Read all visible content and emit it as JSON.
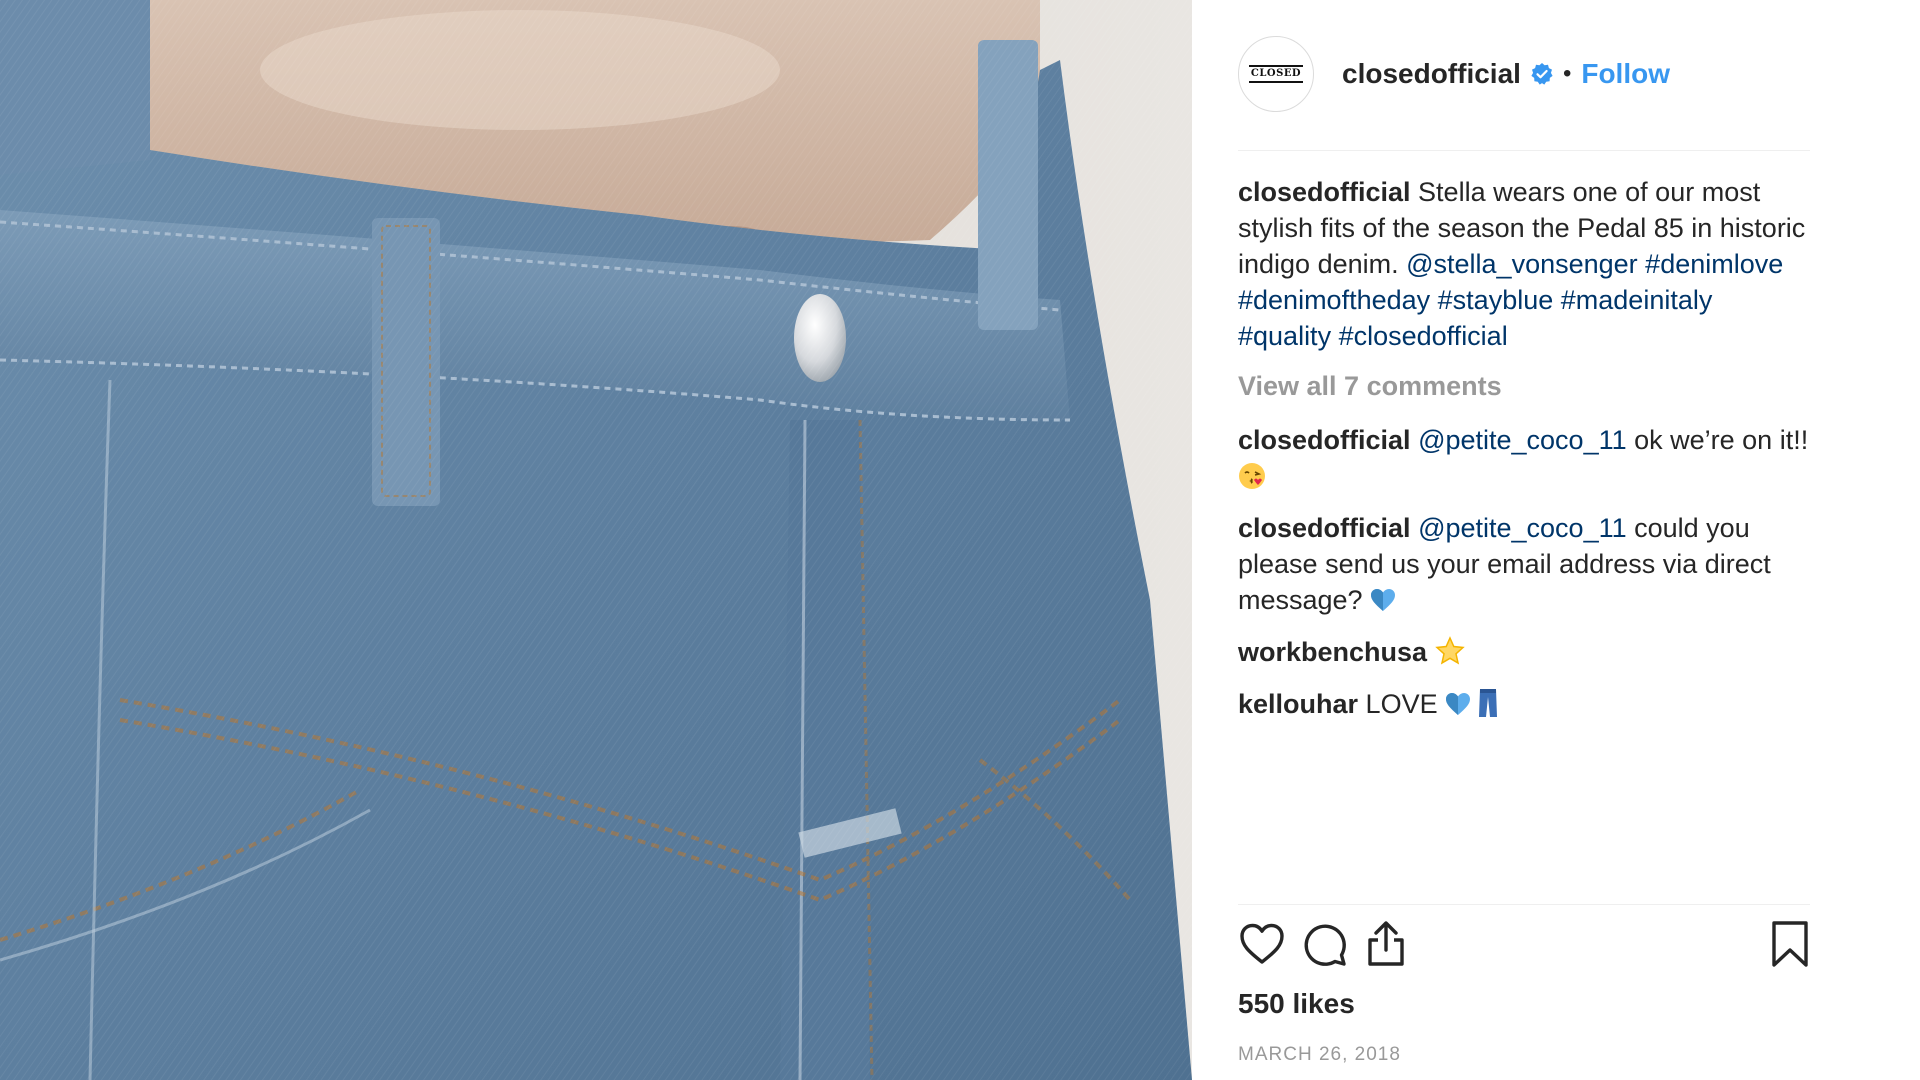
{
  "post": {
    "username": "closedofficial",
    "avatar_logo_text": "CLOSED",
    "separator": "•",
    "follow_label": "Follow"
  },
  "caption": {
    "user": "closedofficial",
    "text": " Stella wears one of our most stylish fits of the season the Pedal 85 in historic indigo denim. ",
    "mention": "@stella_vonsenger",
    "hashtags": [
      "#denimlove",
      "#denimoftheday",
      "#stayblue",
      "#madeinitaly",
      "#quality",
      "#closedofficial"
    ]
  },
  "view_all_comments": "View all 7 comments",
  "comments": [
    {
      "user": "closedofficial",
      "mention": "@petite_coco_11",
      "text": " ok we’re on it!! ",
      "emoji": "kissing-face-emoji"
    },
    {
      "user": "closedofficial",
      "mention": "@petite_coco_11",
      "text": " could you please send us your email address via direct message? ",
      "emoji": "blue-heart-emoji"
    },
    {
      "user": "workbenchusa",
      "text": " ",
      "emoji": "star-emoji"
    },
    {
      "user": "kellouhar",
      "text": " LOVE ",
      "emoji": "blue-heart-emoji"
    }
  ],
  "actions": {
    "icons": [
      "heart-icon",
      "comment-icon",
      "share-icon",
      "bookmark-icon"
    ]
  },
  "likes": "550 likes",
  "date": "MARCH 26, 2018",
  "colors": {
    "link": "#003569",
    "follow": "#3897f0",
    "muted": "#999999",
    "text": "#262626",
    "verified": "#3897f0"
  }
}
